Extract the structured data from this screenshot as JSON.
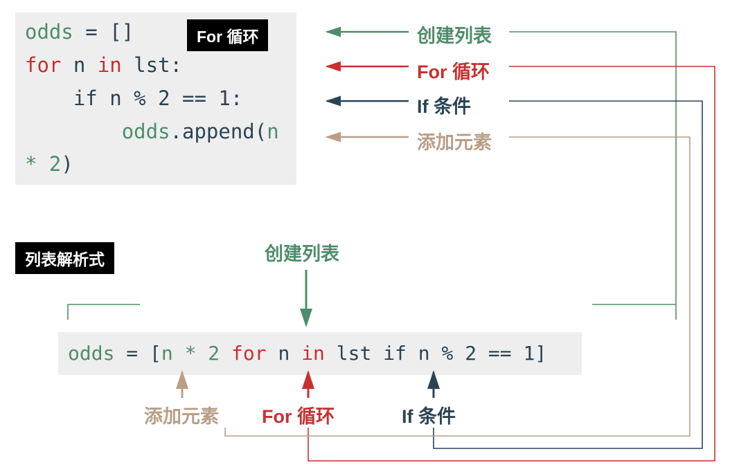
{
  "badges": {
    "for_loop": "For 循环",
    "list_comp": "列表解析式"
  },
  "code1": {
    "line1": {
      "odds": "odds",
      "eq": " = ",
      "brackets": "[]"
    },
    "line2": {
      "for": "for",
      "n": " n ",
      "in": "in",
      "lst": " lst",
      "colon": ":"
    },
    "line3": {
      "indent": "    ",
      "if": "if",
      "rest": " n % 2 == 1:"
    },
    "line4": {
      "indent": "        ",
      "odds": "odds",
      "dot": ".append(",
      "expr": "n * 2",
      "close": ")"
    }
  },
  "code2": {
    "odds": "odds",
    "eq": " = ",
    "lbracket": "[",
    "expr": "n * 2",
    "sp1": " ",
    "for": "for",
    "n": " n ",
    "in": "in",
    "lst": " lst",
    "sp2": " ",
    "if": "if",
    "cond": " n % 2 == 1",
    "rbracket": "]"
  },
  "annotations": {
    "create_list": "创建列表",
    "for_loop": "For 循环",
    "if_cond": "If 条件",
    "append": "添加元素"
  }
}
